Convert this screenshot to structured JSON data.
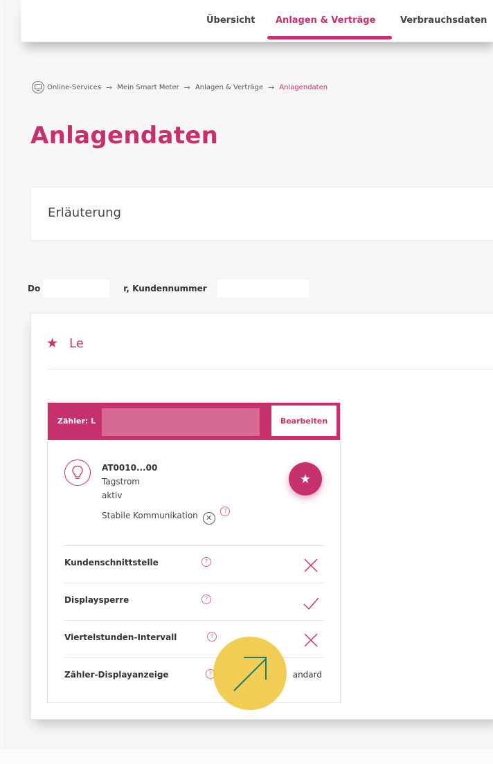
{
  "nav": {
    "items": [
      "Übersicht",
      "Anlagen & Verträge",
      "Verbrauchsdaten"
    ],
    "active": "Anlagen & Verträge"
  },
  "breadcrumb": {
    "items": [
      "Online-Services",
      "Mein Smart Meter",
      "Anlagen & Verträge",
      "Anlagendaten"
    ],
    "separator": "→"
  },
  "page": {
    "title": "Anlagendaten",
    "accordion_label": "Erläuterung",
    "customer_prefix": "Do",
    "customer_suffix": "r, Kundennummer"
  },
  "contract": {
    "title": "Le",
    "star_icon": "★"
  },
  "meter": {
    "header_label": "Zähler: L",
    "edit_label": "Bearbeiten",
    "id": "AT0010...00",
    "tariff": "Tagstrom",
    "status": "aktiv",
    "communication": "Stabile Kommunikation"
  },
  "features": [
    {
      "label": "Kundenschnittstelle",
      "status": "no"
    },
    {
      "label": "Displaysperre",
      "status": "yes"
    },
    {
      "label": "Viertelstunden-Intervall",
      "status": "no"
    },
    {
      "label": "Zähler-Displayanzeige",
      "status_text": "andard"
    }
  ],
  "colors": {
    "brand": "#c6306d",
    "highlight": "#efc841"
  }
}
